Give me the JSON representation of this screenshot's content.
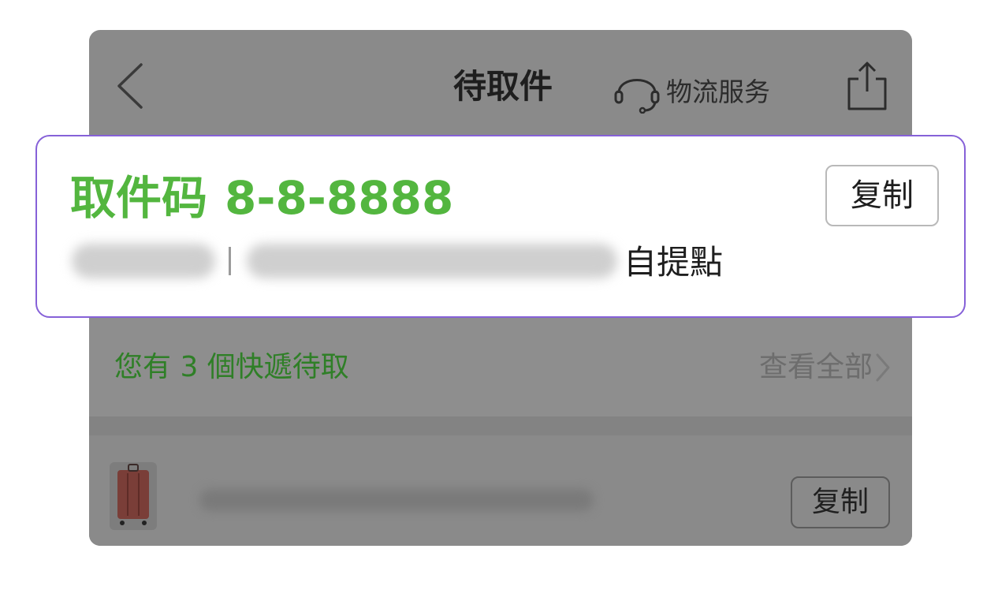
{
  "navbar": {
    "title": "待取件",
    "service_label": "物流服务",
    "back_icon": "chevron-left-icon",
    "service_icon": "headset-icon",
    "share_icon": "share-icon"
  },
  "pickup_card": {
    "code_label": "取件码",
    "code_value": "8-8-8888",
    "copy_label": "复制",
    "location_suffix": "自提點",
    "accent_color": "#53b63f",
    "border_color": "#8661d8"
  },
  "pending": {
    "message": "您有 3 個快遞待取",
    "view_all_label": "查看全部",
    "chevron_icon": "chevron-right-icon"
  },
  "parcel_item": {
    "copy_label": "复制",
    "thumbnail_icon": "suitcase-icon"
  }
}
